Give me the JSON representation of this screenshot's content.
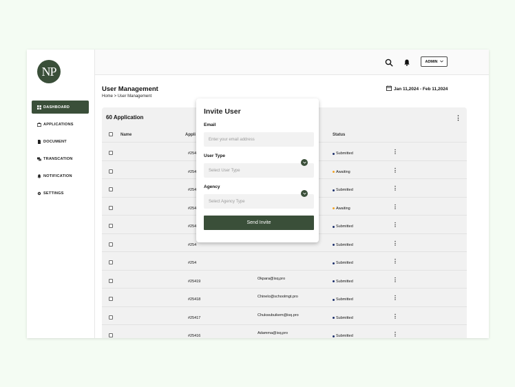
{
  "sidebar": {
    "logo_text": "NP",
    "items": [
      {
        "label": "DASHBOARD",
        "icon": "grid-icon",
        "active": true
      },
      {
        "label": "APPLICATIONS",
        "icon": "briefcase-icon",
        "active": false
      },
      {
        "label": "DOCUMENT",
        "icon": "document-icon",
        "active": false
      },
      {
        "label": "TRANSCATION",
        "icon": "transaction-icon",
        "active": false
      },
      {
        "label": "NOTIFICATION",
        "icon": "bell-icon",
        "active": false
      },
      {
        "label": "SETTINGS",
        "icon": "gear-icon",
        "active": false
      }
    ]
  },
  "header": {
    "admin_label": "ADMIN"
  },
  "page": {
    "title": "User Management",
    "breadcrumb": "Home > User Management",
    "date_range": "Jan 11,2024 - Feb 11,2024"
  },
  "table": {
    "title": "60 Application",
    "columns": {
      "name": "Name",
      "application": "Appli",
      "status": "Status"
    },
    "rows": [
      {
        "id": "#254",
        "email": "",
        "status": "Submitted"
      },
      {
        "id": "#254",
        "email": "",
        "status": "Awaiting"
      },
      {
        "id": "#254",
        "email": "",
        "status": "Submitted"
      },
      {
        "id": "#254",
        "email": "",
        "status": "Awaiting"
      },
      {
        "id": "#254",
        "email": "",
        "status": "Submitted"
      },
      {
        "id": "#254",
        "email": "",
        "status": "Submitted"
      },
      {
        "id": "#254",
        "email": "",
        "status": "Submitted"
      },
      {
        "id": "#25419",
        "email": "Okpara@isq.pro",
        "status": "Submitted"
      },
      {
        "id": "#25418",
        "email": "Chinelo@schoolmgt.pro",
        "status": "Submitted"
      },
      {
        "id": "#25417",
        "email": "Chukwubuikem@isq.pro",
        "status": "Submitted"
      },
      {
        "id": "#25416",
        "email": "Adamma@isq.pro",
        "status": "Submitted"
      }
    ],
    "status_colors": {
      "Submitted": "#1c2f6b",
      "Awaiting": "#f0a429"
    }
  },
  "modal": {
    "title": "Invite User",
    "email_label": "Email",
    "email_placeholder": "Enter your email address",
    "user_type_label": "User Type",
    "user_type_placeholder": "Select User Type",
    "agency_label": "Agency",
    "agency_placeholder": "Select Agency Type",
    "send_label": "Send Invite"
  },
  "colors": {
    "accent": "#3a4f39",
    "background": "#f4fcf3"
  }
}
